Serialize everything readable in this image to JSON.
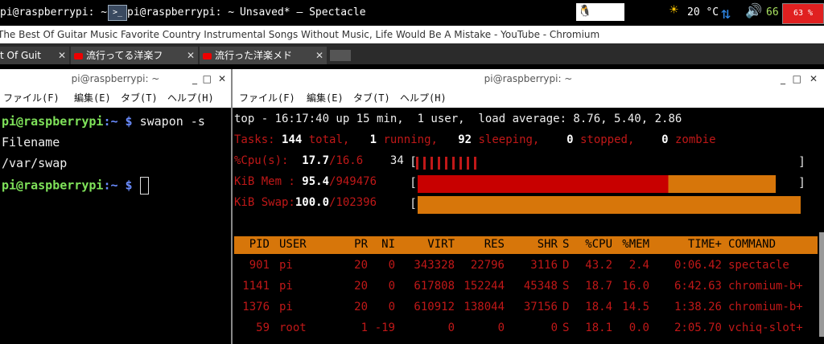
{
  "taskbar": {
    "item1": "pi@raspberrypi: ~",
    "item2": "pi@raspberrypi: ~",
    "item3": "Unsaved* — Spectacle",
    "temp": "20 °C",
    "volume": "66",
    "cpu": "63 %"
  },
  "chromium": {
    "title": "The Best Of Guitar Music Favorite Country Instrumental Songs Without Music, Life Would Be A Mistake - YouTube - Chromium",
    "tabs": [
      {
        "label": "t Of Guit"
      },
      {
        "label": "流行ってる洋楽フ"
      },
      {
        "label": "流行った洋楽メド"
      }
    ]
  },
  "left_term": {
    "title": "pi@raspberrypi: ~",
    "menu": [
      "ファイル(F)",
      "編集(E)",
      "タブ(T)",
      "ヘルプ(H)"
    ],
    "prompt": "pi@raspberrypi",
    "sep": ":~ $",
    "cmd": " swapon -s",
    "out1": "Filename",
    "out2": "/var/swap"
  },
  "top_term": {
    "title": "pi@raspberrypi: ~",
    "menu": [
      "ファイル(F)",
      "編集(E)",
      "タブ(T)",
      "ヘルプ(H)"
    ],
    "uptime_line": "top - 16:17:40 up 15 min,  1 user,  load average: 8.76, 5.40, 2.86",
    "tasks": {
      "label": "Tasks:",
      "total": "144",
      "total_l": " total,",
      "running": "1",
      "running_l": " running,",
      "sleeping": "92",
      "sleeping_l": " sleeping,",
      "stopped": "0",
      "stopped_l": " stopped,",
      "zombie": "0",
      "zombie_l": " zombie"
    },
    "cpu": {
      "label": "%Cpu(s):",
      "v1": "17.7",
      "v2": "/16.6",
      "v3": "34",
      "fill": 0.34
    },
    "mem": {
      "label": "KiB Mem :",
      "v1": "95.4",
      "v2": "/949476",
      "fill": 0.954
    },
    "swap": {
      "label": "KiB Swap:",
      "v1": "100.0",
      "v2": "/102396",
      "fill": 1.0
    },
    "headers": [
      "PID",
      "USER",
      "PR",
      "NI",
      "VIRT",
      "RES",
      "SHR",
      "S",
      "%CPU",
      "%MEM",
      "TIME+",
      "COMMAND"
    ],
    "rows": [
      [
        "901",
        "pi",
        "20",
        "0",
        "343328",
        "22796",
        "3116",
        "D",
        "43.2",
        "2.4",
        "0:06.42",
        "spectacle"
      ],
      [
        "1141",
        "pi",
        "20",
        "0",
        "617808",
        "152244",
        "45348",
        "S",
        "18.7",
        "16.0",
        "6:42.63",
        "chromium-b+"
      ],
      [
        "1376",
        "pi",
        "20",
        "0",
        "610912",
        "138044",
        "37156",
        "D",
        "18.4",
        "14.5",
        "1:38.26",
        "chromium-b+"
      ],
      [
        "59",
        "root",
        "1",
        "-19",
        "0",
        "0",
        "0",
        "S",
        "18.1",
        "0.0",
        "2:05.70",
        "vchiq-slot+"
      ]
    ]
  },
  "colors": {
    "accent_orange": "#d7760a",
    "mem_red": "#c80000",
    "prompt_green": "#7fe25a"
  },
  "icons": [
    "terminal-icon",
    "penguin-icon",
    "keyboard-icon",
    "sun-icon",
    "network-icon",
    "volume-icon"
  ]
}
